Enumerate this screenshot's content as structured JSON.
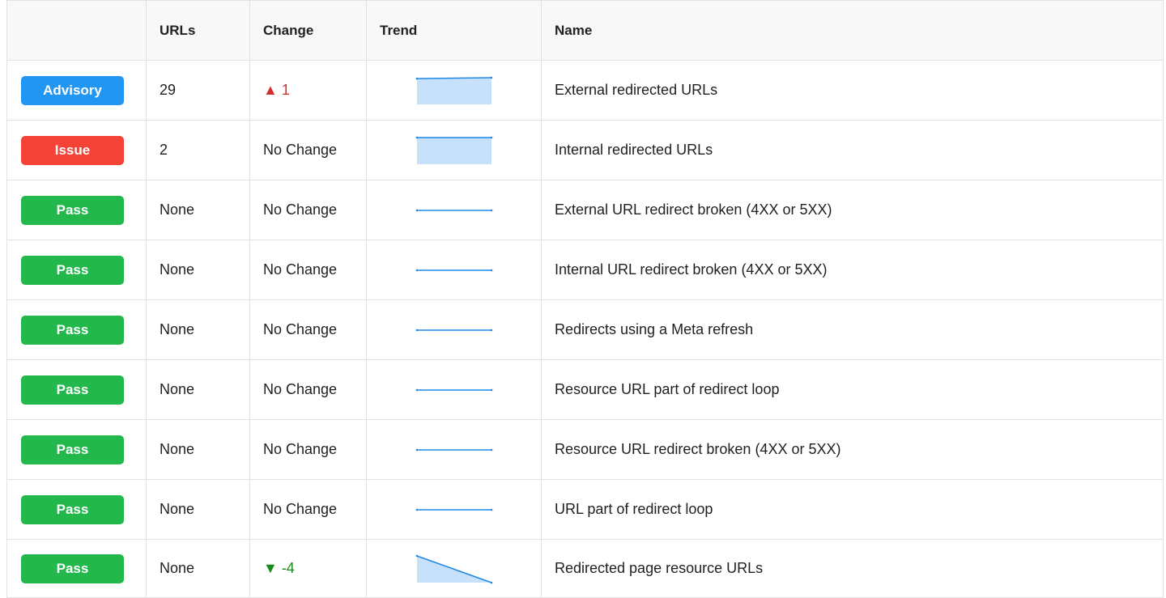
{
  "header": {
    "status": "",
    "urls": "URLs",
    "change": "Change",
    "trend": "Trend",
    "name": "Name"
  },
  "colors": {
    "advisory": "#2196f3",
    "issue": "#f44336",
    "pass": "#22b84b",
    "change_up": "#d32f2f",
    "change_down": "#1a8a1a",
    "sparkline_line": "#1e88e5",
    "sparkline_fill": "#c8e1fb"
  },
  "rows": [
    {
      "status": "Advisory",
      "kind": "advisory",
      "urls": "29",
      "change": "▲ 1",
      "change_dir": "up",
      "trend": [
        28,
        29
      ],
      "name": "External redirected URLs"
    },
    {
      "status": "Issue",
      "kind": "issue",
      "urls": "2",
      "change": "No Change",
      "change_dir": "none",
      "trend": [
        2,
        2
      ],
      "name": "Internal redirected URLs"
    },
    {
      "status": "Pass",
      "kind": "pass",
      "urls": "None",
      "change": "No Change",
      "change_dir": "none",
      "trend": [
        0,
        0
      ],
      "name": "External URL redirect broken (4XX or 5XX)"
    },
    {
      "status": "Pass",
      "kind": "pass",
      "urls": "None",
      "change": "No Change",
      "change_dir": "none",
      "trend": [
        0,
        0
      ],
      "name": "Internal URL redirect broken (4XX or 5XX)"
    },
    {
      "status": "Pass",
      "kind": "pass",
      "urls": "None",
      "change": "No Change",
      "change_dir": "none",
      "trend": [
        0,
        0
      ],
      "name": "Redirects using a Meta refresh"
    },
    {
      "status": "Pass",
      "kind": "pass",
      "urls": "None",
      "change": "No Change",
      "change_dir": "none",
      "trend": [
        0,
        0
      ],
      "name": "Resource URL part of redirect loop"
    },
    {
      "status": "Pass",
      "kind": "pass",
      "urls": "None",
      "change": "No Change",
      "change_dir": "none",
      "trend": [
        0,
        0
      ],
      "name": "Resource URL redirect broken (4XX or 5XX)"
    },
    {
      "status": "Pass",
      "kind": "pass",
      "urls": "None",
      "change": "No Change",
      "change_dir": "none",
      "trend": [
        0,
        0
      ],
      "name": "URL part of redirect loop"
    },
    {
      "status": "Pass",
      "kind": "pass",
      "urls": "None",
      "change": "▼ -4",
      "change_dir": "down",
      "trend": [
        4,
        0
      ],
      "name": "Redirected page resource URLs"
    }
  ]
}
